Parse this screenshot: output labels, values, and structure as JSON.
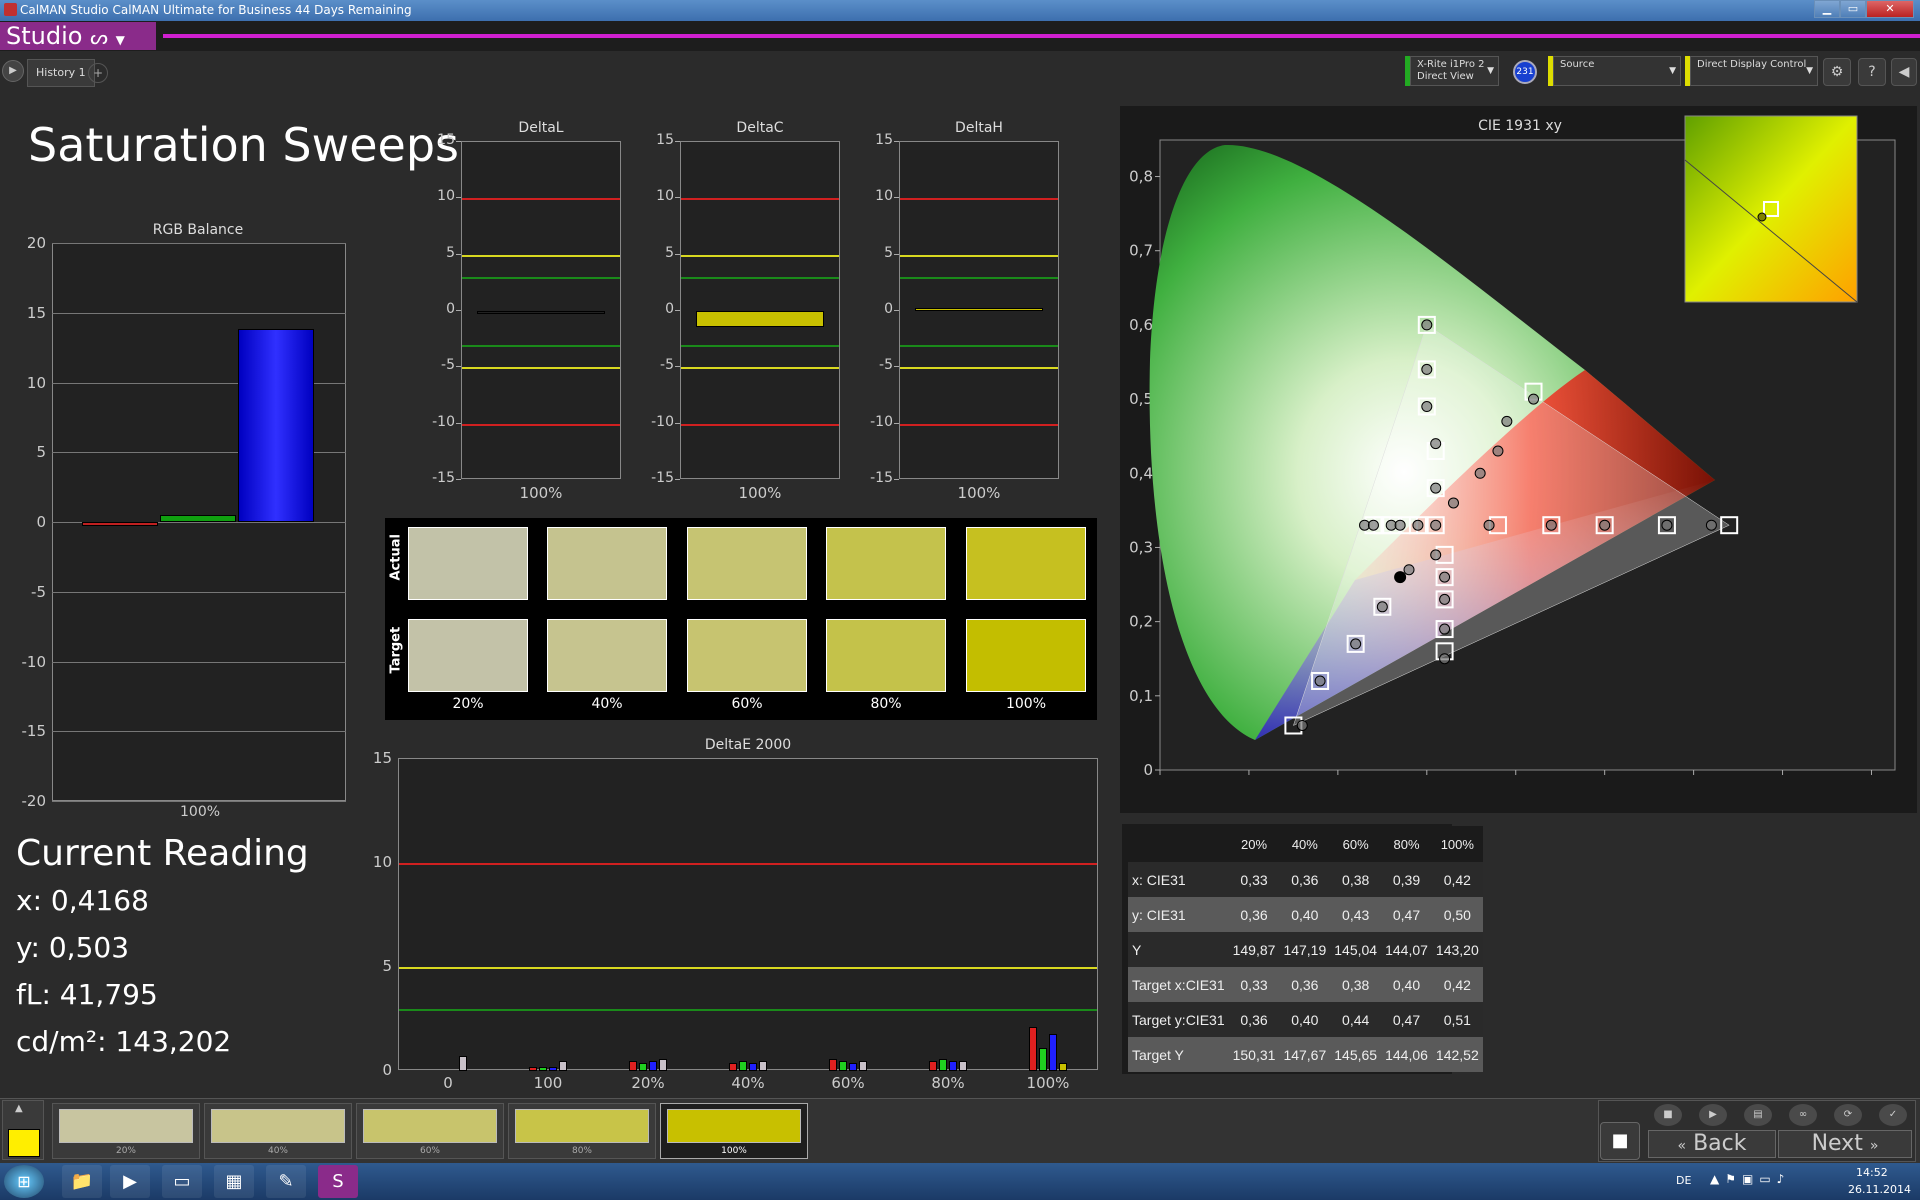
{
  "window": {
    "title": "CalMAN Studio CalMAN Ultimate for Business 44 Days Remaining",
    "min_icon": "minimize-icon",
    "max_icon": "maximize-icon",
    "close_icon": "close-icon"
  },
  "app": {
    "brand": "Studio",
    "brand_color": "#8a2b8a",
    "accent_line": "#d020d0"
  },
  "toolbar": {
    "tab_label": "History 1",
    "add_tab": "+",
    "meter": {
      "line1": "X-Rite i1Pro 2",
      "line2": "Direct View",
      "badge": "231"
    },
    "source_label": "Source",
    "display_label": "Direct Display Control",
    "icons": [
      "gear-icon",
      "help-icon",
      "collapse-icon"
    ]
  },
  "page": {
    "title": "Saturation Sweeps"
  },
  "rgb_balance": {
    "title": "RGB Balance",
    "yticks": [
      "20",
      "15",
      "10",
      "5",
      "0",
      "-5",
      "-10",
      "-15",
      "-20"
    ],
    "xlabel": "100%",
    "ylim": [
      -20,
      20
    ],
    "values": {
      "red": -0.3,
      "green": 0.5,
      "blue": 13.8
    },
    "colors": {
      "red": "#c02020",
      "green": "#10a010",
      "blue": "#1010ff"
    }
  },
  "delta_charts": [
    {
      "title": "DeltaL",
      "xlabel": "100%",
      "value": 0.0,
      "yticks": [
        "15",
        "10",
        "5",
        "0",
        "-5",
        "-10",
        "-15"
      ]
    },
    {
      "title": "DeltaC",
      "xlabel": "100%",
      "value": -1.4,
      "yticks": [
        "15",
        "10",
        "5",
        "0",
        "-5",
        "-10",
        "-15"
      ]
    },
    {
      "title": "DeltaH",
      "xlabel": "100%",
      "value": 0.3,
      "yticks": [
        "15",
        "10",
        "5",
        "0",
        "-5",
        "-10",
        "-15"
      ]
    }
  ],
  "swatches": {
    "row_labels": [
      "Actual",
      "Target"
    ],
    "labels": [
      "20%",
      "40%",
      "60%",
      "80%",
      "100%"
    ],
    "actual": [
      "#c2c2a8",
      "#c5c38f",
      "#c6c472",
      "#c4c24c",
      "#c6c020"
    ],
    "target": [
      "#c3c2a8",
      "#c6c48f",
      "#c7c470",
      "#c4c24a",
      "#c3be00"
    ]
  },
  "deltae": {
    "title": "DeltaE 2000",
    "yticks": [
      "15",
      "10",
      "5",
      "0"
    ],
    "xticks": [
      "0",
      "100",
      "20%",
      "40%",
      "60%",
      "80%",
      "100%"
    ],
    "ylim": [
      0,
      15
    ]
  },
  "current_reading": {
    "title": "Current Reading",
    "x": "x: 0,4168",
    "y": "y: 0,503",
    "fl": "fL: 41,795",
    "cdm2": "cd/m²: 143,202"
  },
  "cie": {
    "title": "CIE 1931 xy",
    "xticks": [
      "0",
      "0,1",
      "0,2",
      "0,3",
      "0,4",
      "0,5",
      "0,6",
      "0,7",
      "0,8"
    ],
    "yticks": [
      "0,8",
      "0,7",
      "0,6",
      "0,5",
      "0,4",
      "0,3",
      "0,2",
      "0,1",
      "0"
    ]
  },
  "table": {
    "headers": [
      "",
      "20%",
      "40%",
      "60%",
      "80%",
      "100%"
    ],
    "rows": [
      [
        "x: CIE31",
        "0,33",
        "0,36",
        "0,38",
        "0,39",
        "0,42"
      ],
      [
        "y: CIE31",
        "0,36",
        "0,40",
        "0,43",
        "0,47",
        "0,50"
      ],
      [
        "Y",
        "149,87",
        "147,19",
        "145,04",
        "144,07",
        "143,20"
      ],
      [
        "Target x:CIE31",
        "0,33",
        "0,36",
        "0,38",
        "0,40",
        "0,42"
      ],
      [
        "Target y:CIE31",
        "0,36",
        "0,40",
        "0,44",
        "0,47",
        "0,51"
      ],
      [
        "Target Y",
        "150,31",
        "147,67",
        "145,65",
        "144,06",
        "142,52"
      ]
    ]
  },
  "bottom": {
    "current_color": "#ffee00",
    "swatch_labels": [
      "20%",
      "40%",
      "60%",
      "80%",
      "100%"
    ],
    "swatch_colors": [
      "#c8c5a0",
      "#c8c48a",
      "#c8c46c",
      "#c8c448",
      "#c8c000"
    ],
    "back": "Back",
    "next": "Next"
  },
  "taskbar": {
    "lang": "DE",
    "time": "14:52",
    "date": "26.11.2014"
  },
  "chart_data": [
    {
      "type": "bar",
      "title": "RGB Balance",
      "categories": [
        "100%"
      ],
      "series": [
        {
          "name": "Red",
          "values": [
            -0.3
          ]
        },
        {
          "name": "Green",
          "values": [
            0.5
          ]
        },
        {
          "name": "Blue",
          "values": [
            13.8
          ]
        }
      ],
      "ylim": [
        -20,
        20
      ]
    },
    {
      "type": "bar",
      "title": "DeltaL",
      "categories": [
        "100%"
      ],
      "values": [
        0.0
      ],
      "ylim": [
        -15,
        15
      ]
    },
    {
      "type": "bar",
      "title": "DeltaC",
      "categories": [
        "100%"
      ],
      "values": [
        -1.4
      ],
      "ylim": [
        -15,
        15
      ]
    },
    {
      "type": "bar",
      "title": "DeltaH",
      "categories": [
        "100%"
      ],
      "values": [
        0.3
      ],
      "ylim": [
        -15,
        15
      ]
    },
    {
      "type": "bar",
      "title": "DeltaE 2000",
      "categories": [
        "0",
        "100",
        "20%",
        "40%",
        "60%",
        "80%",
        "100%"
      ],
      "ylim": [
        0,
        15
      ],
      "series": [
        {
          "name": "Red",
          "values": [
            0,
            0.2,
            0.5,
            0.4,
            0.6,
            0.5,
            2.1
          ]
        },
        {
          "name": "Green",
          "values": [
            0,
            0.2,
            0.4,
            0.5,
            0.5,
            0.6,
            1.1
          ]
        },
        {
          "name": "Blue",
          "values": [
            0,
            0.2,
            0.5,
            0.4,
            0.4,
            0.5,
            1.8
          ]
        },
        {
          "name": "Total",
          "values": [
            0.7,
            0.5,
            0.6,
            0.5,
            0.5,
            0.5,
            0.4
          ]
        }
      ]
    },
    {
      "type": "scatter",
      "title": "CIE 1931 xy",
      "xlim": [
        0,
        0.8
      ],
      "ylim": [
        0,
        0.8
      ],
      "series": [
        {
          "name": "Target",
          "points": [
            [
              0.15,
              0.06
            ],
            [
              0.18,
              0.12
            ],
            [
              0.22,
              0.17
            ],
            [
              0.25,
              0.22
            ],
            [
              0.3,
              0.6
            ],
            [
              0.3,
              0.54
            ],
            [
              0.3,
              0.49
            ],
            [
              0.31,
              0.43
            ],
            [
              0.31,
              0.38
            ],
            [
              0.24,
              0.33
            ],
            [
              0.25,
              0.33
            ],
            [
              0.26,
              0.33
            ],
            [
              0.28,
              0.33
            ],
            [
              0.29,
              0.33
            ],
            [
              0.31,
              0.33
            ],
            [
              0.32,
              0.29
            ],
            [
              0.32,
              0.26
            ],
            [
              0.32,
              0.23
            ],
            [
              0.32,
              0.19
            ],
            [
              0.32,
              0.16
            ],
            [
              0.38,
              0.33
            ],
            [
              0.44,
              0.33
            ],
            [
              0.5,
              0.33
            ],
            [
              0.57,
              0.33
            ],
            [
              0.64,
              0.33
            ],
            [
              0.42,
              0.51
            ]
          ]
        },
        {
          "name": "Actual",
          "points": [
            [
              0.16,
              0.06
            ],
            [
              0.18,
              0.12
            ],
            [
              0.22,
              0.17
            ],
            [
              0.25,
              0.22
            ],
            [
              0.28,
              0.27
            ],
            [
              0.3,
              0.6
            ],
            [
              0.3,
              0.54
            ],
            [
              0.3,
              0.49
            ],
            [
              0.31,
              0.44
            ],
            [
              0.31,
              0.38
            ],
            [
              0.33,
              0.36
            ],
            [
              0.36,
              0.4
            ],
            [
              0.38,
              0.43
            ],
            [
              0.39,
              0.47
            ],
            [
              0.42,
              0.5
            ],
            [
              0.23,
              0.33
            ],
            [
              0.24,
              0.33
            ],
            [
              0.26,
              0.33
            ],
            [
              0.27,
              0.33
            ],
            [
              0.29,
              0.33
            ],
            [
              0.31,
              0.33
            ],
            [
              0.31,
              0.29
            ],
            [
              0.32,
              0.26
            ],
            [
              0.32,
              0.23
            ],
            [
              0.32,
              0.19
            ],
            [
              0.32,
              0.15
            ],
            [
              0.37,
              0.33
            ],
            [
              0.44,
              0.33
            ],
            [
              0.5,
              0.33
            ],
            [
              0.57,
              0.33
            ],
            [
              0.62,
              0.33
            ]
          ]
        }
      ]
    }
  ]
}
